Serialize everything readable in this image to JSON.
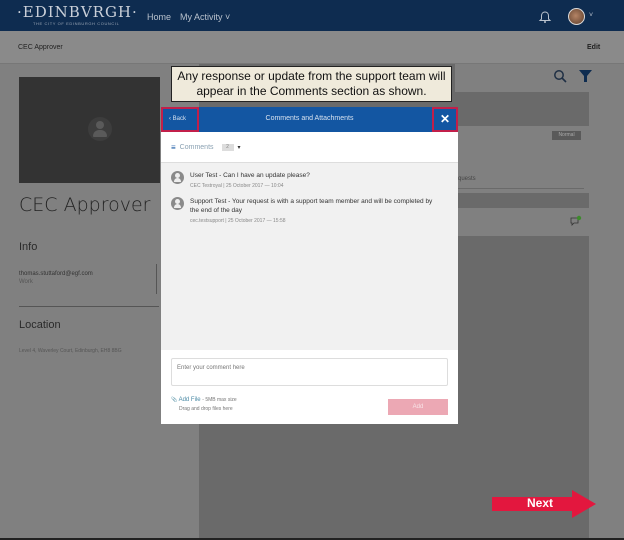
{
  "header": {
    "logo": "·EDINBVRGH·",
    "logo_subtitle": "THE CITY OF EDINBURGH COUNCIL",
    "nav": [
      {
        "label": "Home"
      },
      {
        "label": "My Activity ˅"
      }
    ],
    "icons": [
      "bell-icon",
      "avatar",
      "chevron-down-icon"
    ],
    "avatar_chevron": "˅"
  },
  "subheader": {
    "title": "CEC Approver",
    "edit_label": "Edit"
  },
  "profile": {
    "name": "CEC Approver",
    "info_heading": "Info",
    "email": "thomas.stuttaford@egf.com",
    "email_type": "Work",
    "location_heading": "Location",
    "location_text": "Level 4, Waverley Court, Edinburgh, EH8 8BG"
  },
  "background": {
    "badge": "Normal",
    "card_text": "quests"
  },
  "callout": {
    "text": "Any response or update from the support team will appear in the Comments section as shown."
  },
  "modal": {
    "title": "Comments and Attachments",
    "back_label": "‹ Back",
    "close_label": "✕",
    "tab_label": "Comments",
    "tab_icon": "≡",
    "comment_count": "2",
    "caret": "▾",
    "comments": [
      {
        "text": "User Test - Can I have an update please?",
        "meta": "CEC Testroyal | 25 October 2017 — 10:04"
      },
      {
        "text": "Support Test - Your request is with a support team member and will be completed by the end of the day",
        "meta": "cec.testsupport | 25 October 2017 — 15:58"
      }
    ],
    "input_placeholder": "Enter your comment here",
    "add_file_icon": "📎",
    "add_file_label": "Add File",
    "add_file_note": " - 5MB max size",
    "drag_text": "Drag and drop files here",
    "add_button": "Add"
  },
  "next_button": {
    "label": "Next",
    "color": "#e3173e"
  },
  "colors": {
    "header": "#0e2c50",
    "modal_header": "#1356a2",
    "highlight": "#c21f4a"
  }
}
